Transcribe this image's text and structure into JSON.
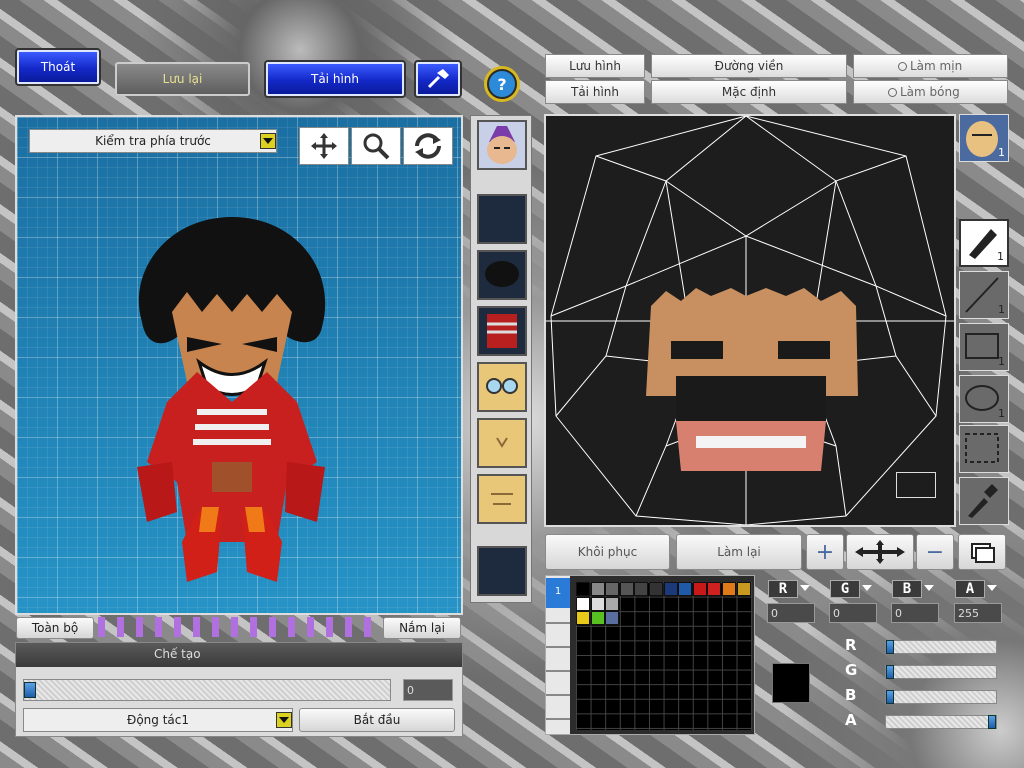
{
  "top_left": {
    "exit_label": "Thoát",
    "save_label": "Lưu lại",
    "reload_label": "Tải hình",
    "hammer_icon": "hammer-icon"
  },
  "help_icon": "question-icon",
  "view_select": {
    "value": "Kiểm tra phía trước",
    "icons": [
      "move-arrows-icon",
      "magnify-icon",
      "rotate-icon"
    ]
  },
  "bottom_left": {
    "all_label": "Toàn bộ",
    "grab_label": "Nắm lại",
    "section_title": "Chế tạo",
    "progress_value": "0",
    "progress_fraction": 0,
    "motion_value": "Động tác1",
    "start_label": "Bắt đầu"
  },
  "parts_strip": {
    "thumbs": [
      "head",
      "empty",
      "hair",
      "body",
      "glasses",
      "face-a",
      "face-b",
      "empty"
    ]
  },
  "right_top": {
    "save_label": "Lưu hình",
    "load_label": "Tải hình",
    "outline_label": "Đường viền",
    "default_label": "Mặc định",
    "smooth_label": "Làm mịn",
    "gloss_label": "Làm bóng"
  },
  "side_tools": [
    {
      "name": "face-thumb",
      "count": "1"
    },
    {
      "name": "pen-icon",
      "count": "1"
    },
    {
      "name": "line-icon",
      "count": "1"
    },
    {
      "name": "rectangle-icon",
      "count": "1"
    },
    {
      "name": "ellipse-icon",
      "count": "1"
    },
    {
      "name": "select-icon",
      "count": ""
    },
    {
      "name": "eyedropper-icon",
      "count": ""
    }
  ],
  "canvas_bottom": {
    "restore_label": "Khôi phục",
    "redo_label": "Làm lại"
  },
  "palette": {
    "row1": [
      "#000000",
      "#888888",
      "#666666",
      "#555555",
      "#444444",
      "#333333",
      "#1c3a7a",
      "#1f5aa8",
      "#c81818",
      "#d02020",
      "#e07a18",
      "#c89a20"
    ],
    "row2": [
      "#ffffff",
      "#dddddd",
      "#aaaaaa"
    ],
    "row3": [
      "#e8c818",
      "#58c020",
      "#5a6ea0"
    ],
    "current_color": "#000000"
  },
  "color": {
    "r": "0",
    "g": "0",
    "b": "0",
    "a": "255",
    "r_label": "R",
    "g_label": "G",
    "b_label": "B",
    "a_label": "A",
    "r_fraction": 0,
    "g_fraction": 0,
    "b_fraction": 0,
    "a_fraction": 1
  }
}
